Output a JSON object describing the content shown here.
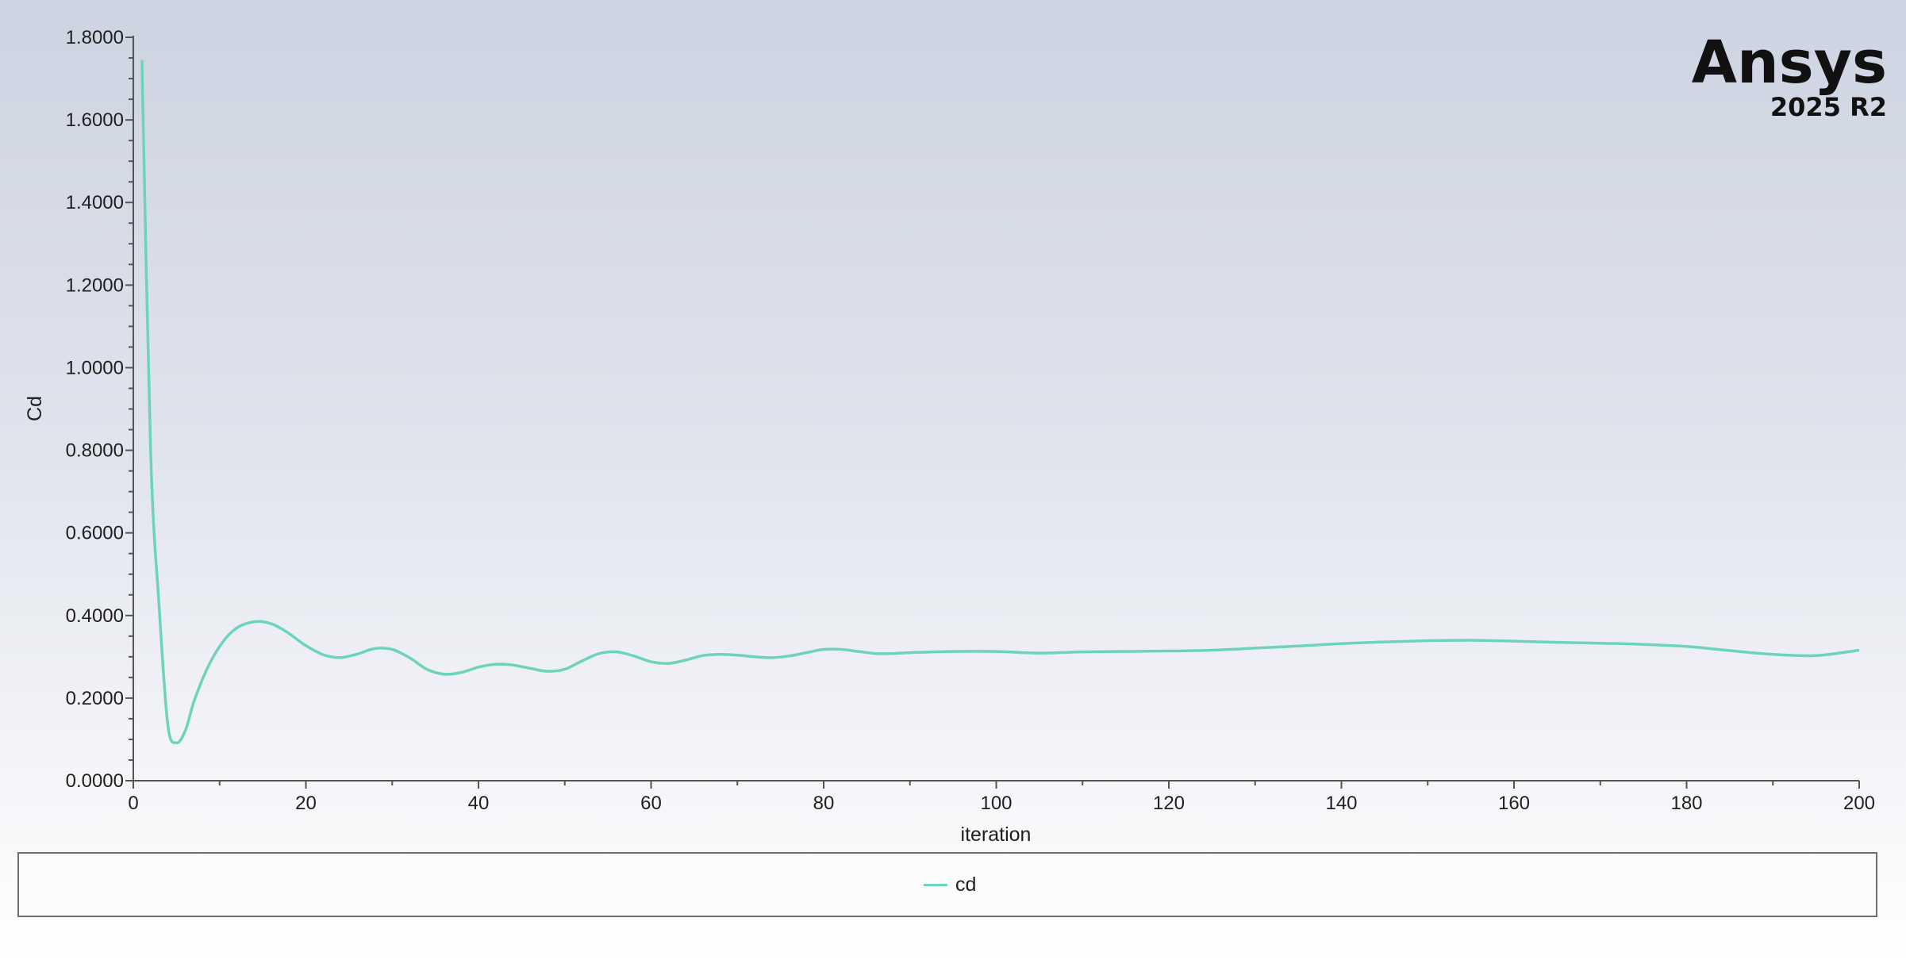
{
  "branding": {
    "logo_text": "Ansys",
    "version": "2025 R2"
  },
  "legend": {
    "items": [
      {
        "label": "cd",
        "color": "#6dd3bb"
      }
    ]
  },
  "colors": {
    "series": "#6dd3bb",
    "axis": "#555555"
  },
  "chart_data": {
    "type": "line",
    "title": "",
    "xlabel": "iteration",
    "ylabel": "Cd",
    "xlim": [
      0,
      200
    ],
    "ylim": [
      0,
      1.8
    ],
    "xticks": [
      0,
      20,
      40,
      60,
      80,
      100,
      120,
      140,
      160,
      180,
      200
    ],
    "xtick_labels": [
      "0",
      "20",
      "40",
      "60",
      "80",
      "100",
      "120",
      "140",
      "160",
      "180",
      "200"
    ],
    "yticks": [
      0,
      0.2,
      0.4,
      0.6,
      0.8,
      1.0,
      1.2,
      1.4,
      1.6,
      1.8
    ],
    "ytick_labels": [
      "0.0000",
      "0.2000",
      "0.4000",
      "0.6000",
      "0.8000",
      "1.0000",
      "1.2000",
      "1.4000",
      "1.6000",
      "1.8000"
    ],
    "grid": false,
    "legend_position": "bottom",
    "series": [
      {
        "name": "cd",
        "color": "#6dd3bb",
        "x": [
          1,
          2,
          3,
          4,
          5,
          6,
          7,
          8,
          9,
          10,
          11,
          12,
          13,
          14,
          15,
          16,
          17,
          18,
          19,
          20,
          22,
          24,
          26,
          28,
          30,
          32,
          34,
          36,
          38,
          40,
          42,
          44,
          46,
          48,
          50,
          52,
          54,
          56,
          58,
          60,
          62,
          64,
          66,
          68,
          70,
          72,
          74,
          76,
          78,
          80,
          82,
          84,
          86,
          88,
          90,
          95,
          100,
          105,
          110,
          115,
          120,
          125,
          130,
          135,
          140,
          145,
          150,
          155,
          160,
          165,
          170,
          175,
          180,
          185,
          190,
          195,
          200
        ],
        "y": [
          1.745,
          0.8,
          0.42,
          0.135,
          0.092,
          0.12,
          0.19,
          0.245,
          0.29,
          0.325,
          0.352,
          0.37,
          0.38,
          0.385,
          0.385,
          0.38,
          0.37,
          0.357,
          0.342,
          0.327,
          0.305,
          0.298,
          0.307,
          0.32,
          0.318,
          0.298,
          0.27,
          0.258,
          0.262,
          0.275,
          0.282,
          0.28,
          0.272,
          0.265,
          0.27,
          0.29,
          0.308,
          0.312,
          0.302,
          0.288,
          0.284,
          0.292,
          0.303,
          0.306,
          0.304,
          0.3,
          0.298,
          0.302,
          0.31,
          0.318,
          0.318,
          0.313,
          0.308,
          0.308,
          0.31,
          0.313,
          0.313,
          0.309,
          0.312,
          0.313,
          0.314,
          0.316,
          0.321,
          0.326,
          0.332,
          0.336,
          0.339,
          0.34,
          0.338,
          0.335,
          0.333,
          0.33,
          0.325,
          0.315,
          0.306,
          0.303,
          0.316
        ]
      }
    ]
  }
}
